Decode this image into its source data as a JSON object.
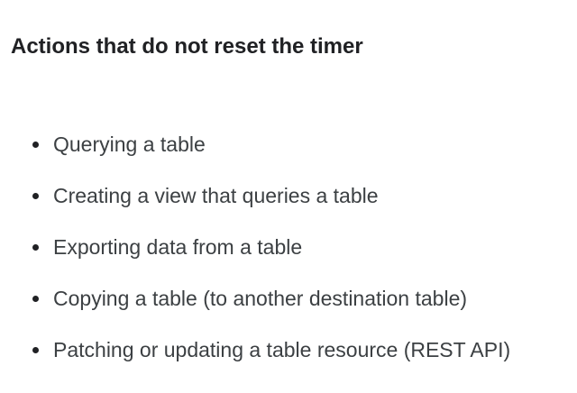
{
  "section": {
    "heading": "Actions that do not reset the timer",
    "items": [
      "Querying a table",
      "Creating a view that queries a table",
      "Exporting data from a table",
      "Copying a table (to another destination table)",
      "Patching or updating a table resource (REST API)"
    ]
  }
}
